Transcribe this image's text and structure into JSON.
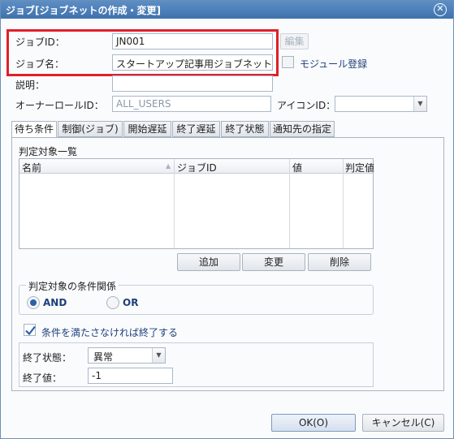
{
  "window": {
    "title": "ジョブ[ジョブネットの作成・変更]"
  },
  "form": {
    "job_id_label": "ジョブID：",
    "job_id_value": "JN001",
    "edit_button": "編集",
    "job_name_label": "ジョブ名：",
    "job_name_value": "スタートアップ記事用ジョブネット",
    "module_label": "モジュール登録",
    "description_label": "説明：",
    "description_value": "",
    "owner_label": "オーナーロールID：",
    "owner_value": "ALL_USERS",
    "icon_label": "アイコンID：",
    "icon_value": ""
  },
  "tabs": [
    {
      "label": "待ち条件"
    },
    {
      "label": "制御(ジョブ)"
    },
    {
      "label": "開始遅延"
    },
    {
      "label": "終了遅延"
    },
    {
      "label": "終了状態"
    },
    {
      "label": "通知先の指定"
    }
  ],
  "wait": {
    "list_title": "判定対象一覧",
    "columns": [
      "名前",
      "ジョブID",
      "値",
      "判定値"
    ],
    "add_button": "追加",
    "change_button": "変更",
    "delete_button": "削除",
    "relation_title": "判定対象の条件関係",
    "and_label": "AND",
    "or_label": "OR",
    "end_if_unmet_label": "条件を満たさなければ終了する",
    "end_status_label": "終了状態：",
    "end_status_value": "異常",
    "end_value_label": "終了値：",
    "end_value_value": "-1"
  },
  "footer": {
    "ok_button": "OK(O)",
    "cancel_button": "キャンセル(C)"
  }
}
